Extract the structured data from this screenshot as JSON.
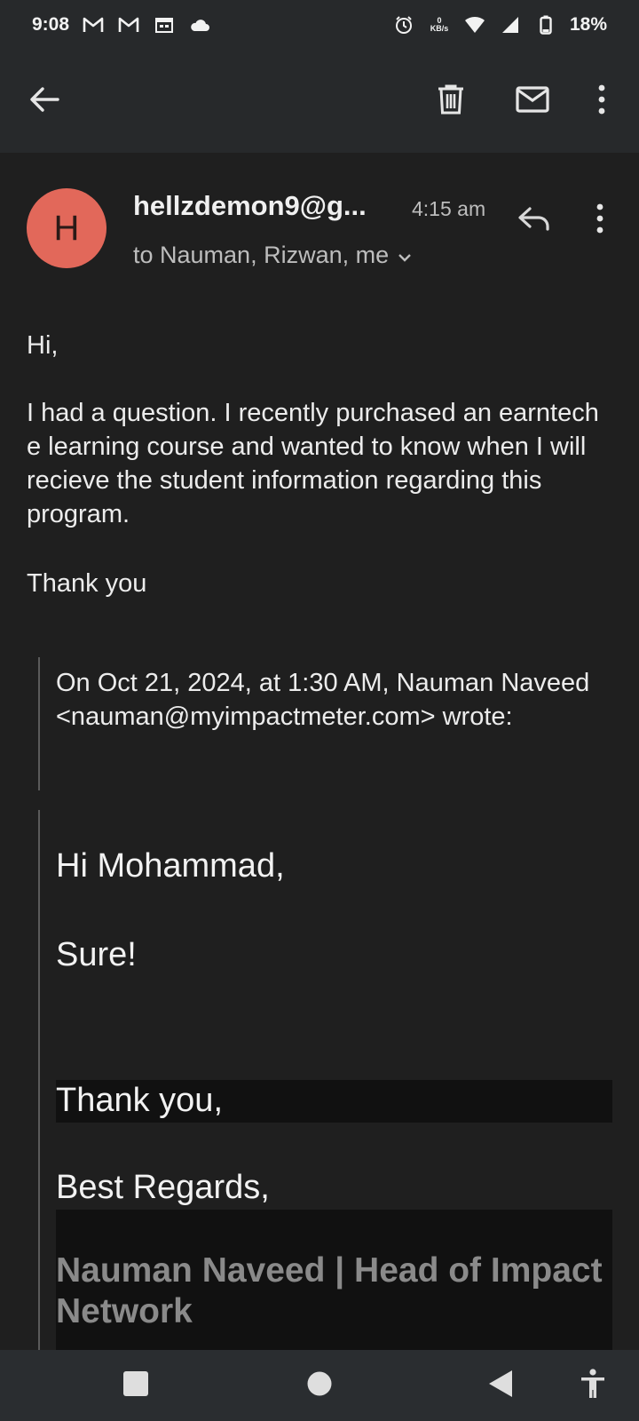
{
  "status_bar": {
    "time": "9:08",
    "left_icons": [
      "gmail-icon",
      "gmail-icon",
      "calendar-icon",
      "cloud-icon"
    ],
    "right_icons": [
      "alarm-icon",
      "data-speed-icon",
      "wifi-icon",
      "signal-icon",
      "battery-icon"
    ],
    "data_speed_value": "0",
    "data_speed_unit": "KB/s",
    "battery": "18%"
  },
  "app_bar": {
    "icons": [
      "back-arrow-icon",
      "trash-icon",
      "mail-icon",
      "more-vert-icon"
    ]
  },
  "header": {
    "avatar_letter": "H",
    "avatar_color": "#e2685a",
    "sender": "hellzdemon9@g...",
    "time": "4:15 am",
    "recipients": "to Nauman, Rizwan, me"
  },
  "body": {
    "greeting": "Hi,",
    "paragraph": "I had a question. I recently purchased an earntech e learning course and wanted to know when I will recieve the student information regarding this program.",
    "closing": "Thank you"
  },
  "quoted": {
    "attribution": "On Oct 21, 2024, at 1:30 AM, Nauman Naveed <nauman@myimpactmeter.com> wrote:",
    "greeting": "Hi Mohammad,",
    "line": "Sure!",
    "thanks": "Thank you,",
    "regards": "Best Regards,",
    "signature": "Nauman Naveed | Head of Impact Network"
  },
  "nav_bar": {
    "icons": [
      "recents-square-icon",
      "home-circle-icon",
      "back-triangle-icon",
      "accessibility-icon"
    ]
  }
}
